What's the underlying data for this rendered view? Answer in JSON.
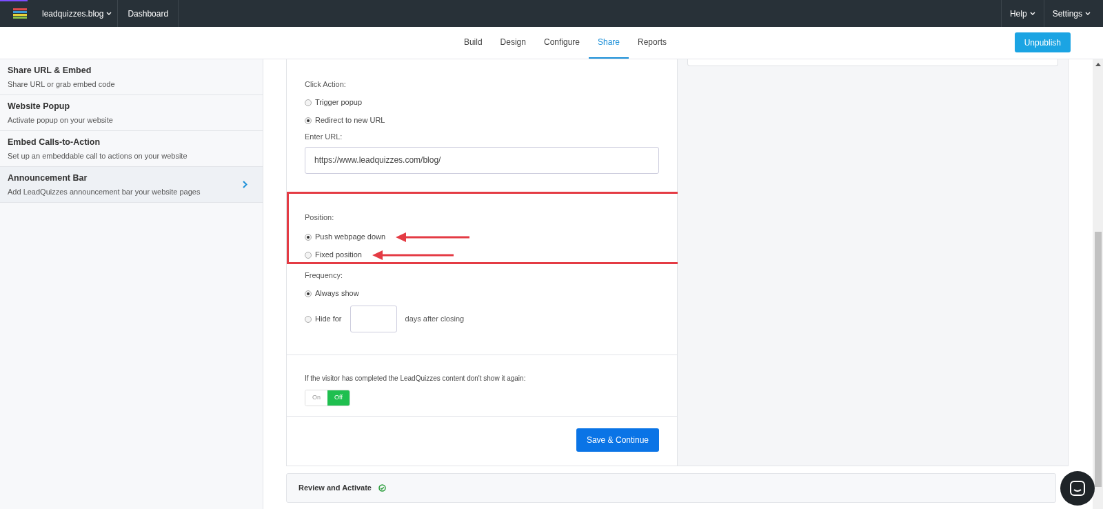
{
  "topbar": {
    "site": "leadquizzes.blog",
    "dashboard": "Dashboard",
    "help": "Help",
    "settings": "Settings"
  },
  "tabs": [
    {
      "label": "Build",
      "selected": false
    },
    {
      "label": "Design",
      "selected": false
    },
    {
      "label": "Configure",
      "selected": false
    },
    {
      "label": "Share",
      "selected": true
    },
    {
      "label": "Reports",
      "selected": false
    }
  ],
  "unpublish": "Unpublish",
  "sidebar": {
    "items": [
      {
        "title": "Share URL & Embed",
        "subtitle": "Share URL or grab embed code",
        "selected": false
      },
      {
        "title": "Website Popup",
        "subtitle": "Activate popup on your website",
        "selected": false
      },
      {
        "title": "Embed Calls-to-Action",
        "subtitle": "Set up an embeddable call to actions on your website",
        "selected": false
      },
      {
        "title": "Announcement Bar",
        "subtitle": "Add LeadQuizzes announcement bar your website pages",
        "selected": true
      }
    ]
  },
  "click_action": {
    "label": "Click Action:",
    "options": [
      {
        "label": "Trigger popup",
        "selected": false
      },
      {
        "label": "Redirect to new URL",
        "selected": true
      }
    ]
  },
  "url": {
    "label": "Enter URL:",
    "value": "https://www.leadquizzes.com/blog/"
  },
  "position": {
    "label": "Position:",
    "options": [
      {
        "label": "Push webpage down",
        "selected": true
      },
      {
        "label": "Fixed position",
        "selected": false
      }
    ]
  },
  "frequency": {
    "label": "Frequency:",
    "always": {
      "label": "Always show",
      "selected": true
    },
    "hide": {
      "label": "Hide for",
      "suffix": "days after closing",
      "selected": false
    }
  },
  "completed": {
    "label": "If the visitor has completed the LeadQuizzes content don't show it again:",
    "options": [
      {
        "label": "On",
        "selected": false
      },
      {
        "label": "Off",
        "selected": true
      }
    ]
  },
  "save": "Save & Continue",
  "review": {
    "label": "Review and Activate",
    "done": true
  }
}
